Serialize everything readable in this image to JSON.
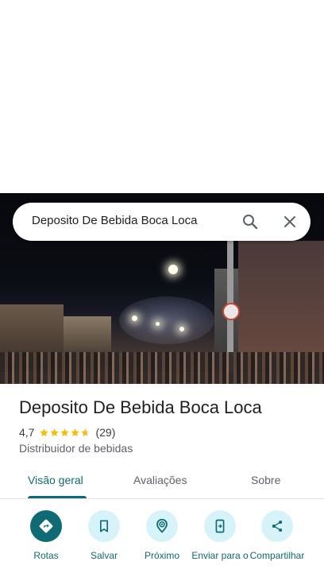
{
  "search": {
    "query": "Deposito De Bebida Boca Loca"
  },
  "place": {
    "title": "Deposito De Bebida Boca Loca",
    "rating": "4,7",
    "rating_value": 4.7,
    "rating_max": 5,
    "review_count": "(29)",
    "category": "Distribuidor de bebidas"
  },
  "tabs": [
    {
      "label": "Visão geral",
      "active": true
    },
    {
      "label": "Avaliações",
      "active": false
    },
    {
      "label": "Sobre",
      "active": false
    }
  ],
  "actions": [
    {
      "label": "Rotas",
      "icon": "directions-icon"
    },
    {
      "label": "Salvar",
      "icon": "bookmark-icon"
    },
    {
      "label": "Próximo",
      "icon": "nearby-icon"
    },
    {
      "label": "Enviar para o",
      "icon": "send-to-phone-icon"
    },
    {
      "label": "Compartilhar",
      "icon": "share-icon"
    }
  ],
  "colors": {
    "accent": "#0f6b73",
    "action_bg": "#d6f3fa",
    "star": "#fbbc04"
  }
}
